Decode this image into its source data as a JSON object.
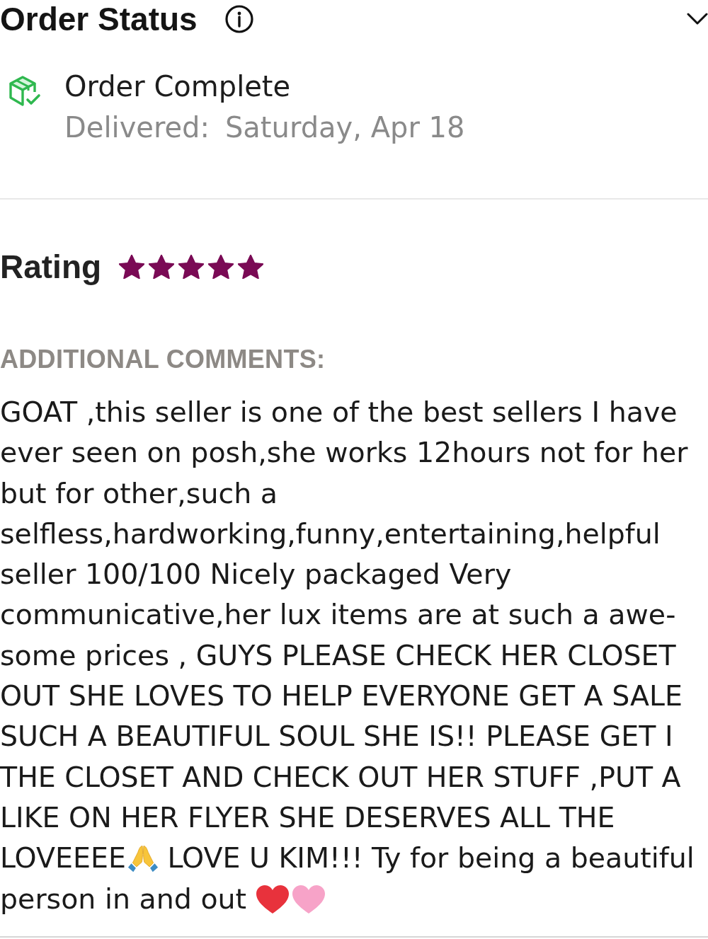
{
  "order_status": {
    "title": "Order Status",
    "status": "Order Complete",
    "delivered_label": "Delivered:",
    "delivered_date": "Saturday, Apr 18"
  },
  "rating": {
    "label": "Rating",
    "stars": 5
  },
  "comments": {
    "heading": "ADDITIONAL COMMENTS:",
    "lines": [
      [
        {
          "kind": "text",
          "text": "GOAT ,this seller is one of the best sellers I have"
        }
      ],
      [
        {
          "kind": "text",
          "text": "ever seen on posh,she works 12hours not for her"
        }
      ],
      [
        {
          "kind": "text",
          "text": "but for other,such a"
        }
      ],
      [
        {
          "kind": "text",
          "text": "selfless,hardworking,funny,entertaining,helpful"
        }
      ],
      [
        {
          "kind": "text",
          "text": "seller 100/100 Nicely packaged Very"
        }
      ],
      [
        {
          "kind": "text",
          "text": "communicative,her lux items are at such a awe-"
        }
      ],
      [
        {
          "kind": "text",
          "text": "some prices , GUYS PLEASE CHECK HER CLOSET"
        }
      ],
      [
        {
          "kind": "text",
          "text": "OUT SHE LOVES TO HELP EVERYONE GET A SALE"
        }
      ],
      [
        {
          "kind": "text",
          "text": "SUCH A BEAUTIFUL SOUL SHE IS!! PLEASE GET I"
        }
      ],
      [
        {
          "kind": "text",
          "text": "THE CLOSET AND CHECK OUT HER STUFF ,PUT A"
        }
      ],
      [
        {
          "kind": "text",
          "text": "LIKE ON HER FLYER SHE DESERVES ALL THE"
        }
      ],
      [
        {
          "kind": "text",
          "text": "LOVEEEE"
        },
        {
          "kind": "pray"
        },
        {
          "kind": "text",
          "text": " LOVE U KIM!!! Ty for being a beautiful"
        }
      ],
      [
        {
          "kind": "text",
          "text": "person in and out "
        },
        {
          "kind": "heart",
          "color": "#e8323c"
        },
        {
          "kind": "heart",
          "color": "#f7a3c8"
        }
      ]
    ]
  }
}
